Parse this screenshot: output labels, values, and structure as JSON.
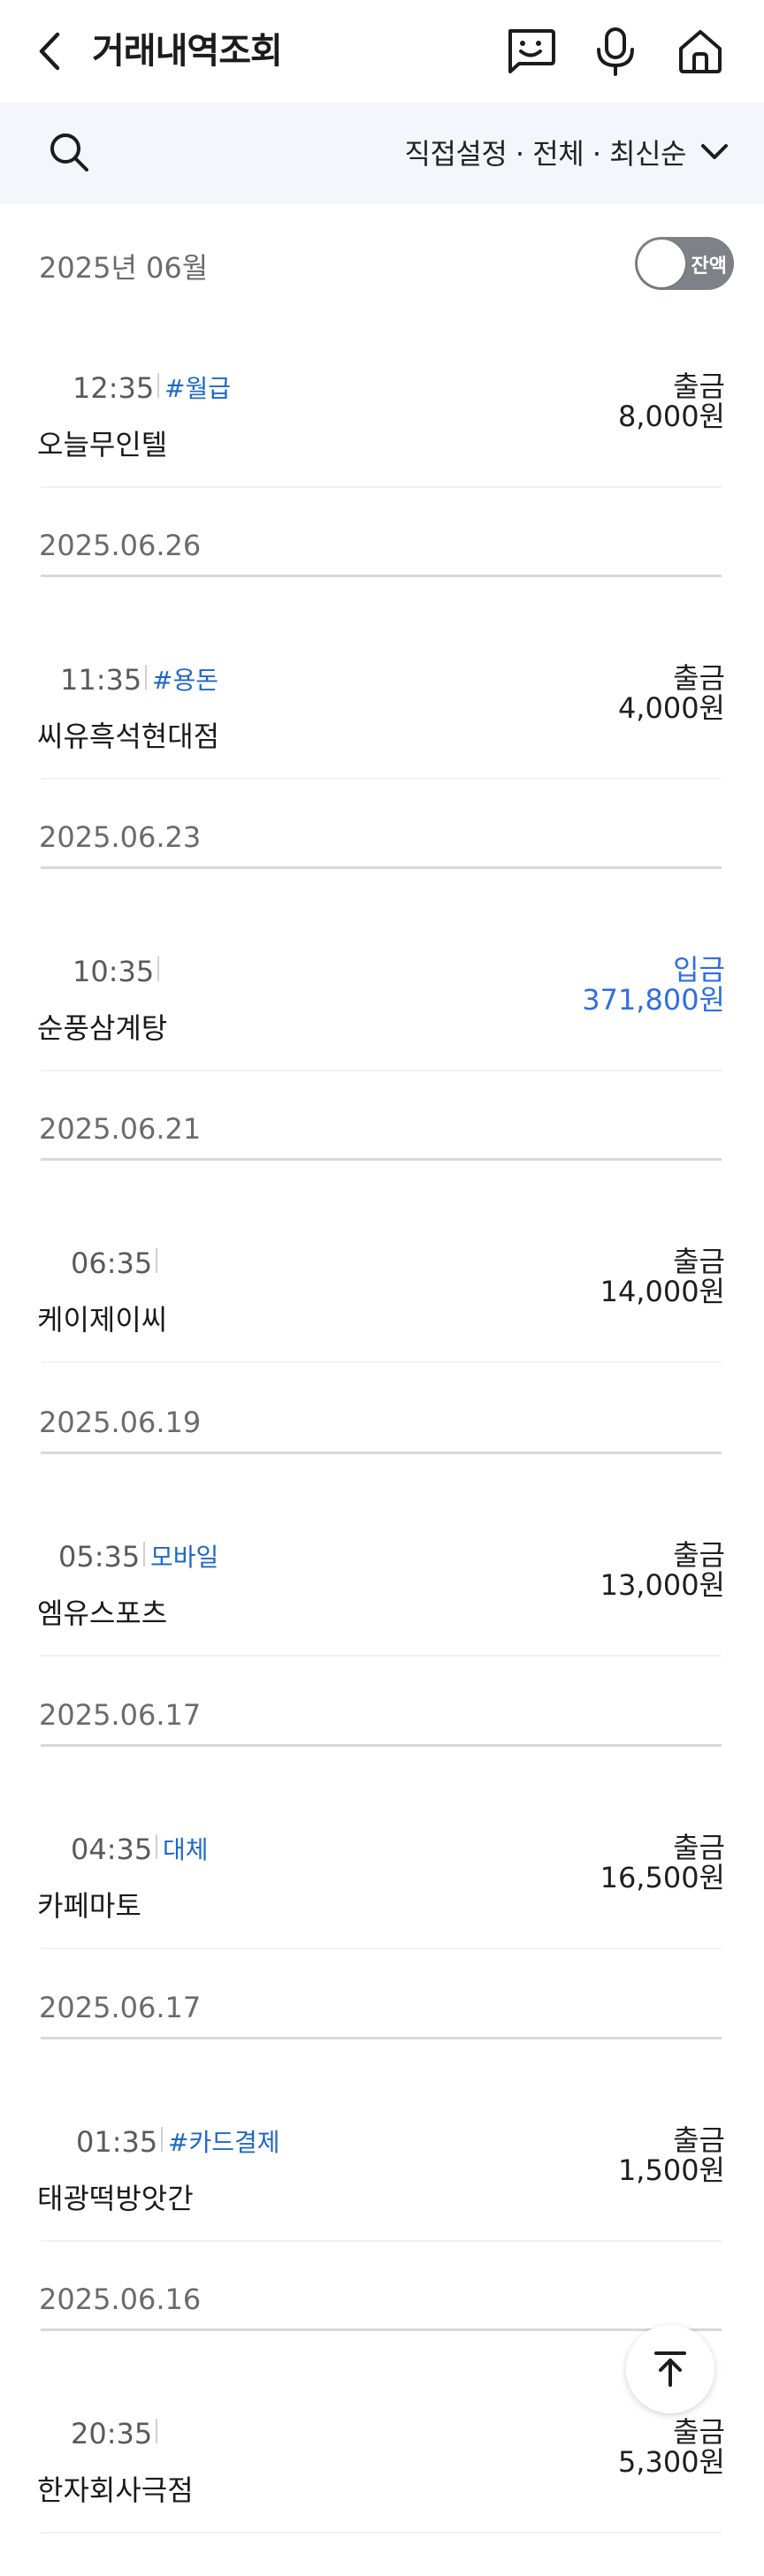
{
  "header": {
    "title": "거래내역조회",
    "icons": [
      "back-arrow-icon",
      "chatbot-icon",
      "microphone-icon",
      "home-icon"
    ]
  },
  "filter": {
    "summary": "직접설정 · 전체 · 최신순"
  },
  "month": {
    "label": "2025년 06월",
    "balance_toggle_label": "잔액",
    "balance_toggle_on": false
  },
  "groups": [
    {
      "date": "",
      "transactions": [
        {
          "time": "12:35",
          "memo": "#월급",
          "name": "오늘무인텔",
          "type": "출금",
          "amount": "8,000원",
          "kind": "withdrawal"
        }
      ]
    },
    {
      "date": "2025.06.26",
      "transactions": [
        {
          "time": "11:35",
          "memo": "#용돈",
          "name": "씨유흑석현대점",
          "type": "출금",
          "amount": "4,000원",
          "kind": "withdrawal"
        }
      ]
    },
    {
      "date": "2025.06.23",
      "transactions": [
        {
          "time": "10:35",
          "memo": "",
          "name": "순풍삼계탕",
          "type": "입금",
          "amount": "371,800원",
          "kind": "deposit"
        }
      ]
    },
    {
      "date": "2025.06.21",
      "transactions": [
        {
          "time": "06:35",
          "memo": "",
          "name": "케이제이씨",
          "type": "출금",
          "amount": "14,000원",
          "kind": "withdrawal"
        }
      ]
    },
    {
      "date": "2025.06.19",
      "transactions": [
        {
          "time": "05:35",
          "memo": "모바일",
          "name": "엠유스포츠",
          "type": "출금",
          "amount": "13,000원",
          "kind": "withdrawal"
        }
      ]
    },
    {
      "date": "2025.06.17",
      "transactions": [
        {
          "time": "04:35",
          "memo": "대체",
          "name": "카페마토",
          "type": "출금",
          "amount": "16,500원",
          "kind": "withdrawal"
        }
      ]
    },
    {
      "date": "2025.06.17",
      "transactions": [
        {
          "time": "01:35",
          "memo": "#카드결제",
          "name": "태광떡방앗간",
          "type": "출금",
          "amount": "1,500원",
          "kind": "withdrawal"
        }
      ]
    },
    {
      "date": "2025.06.16",
      "transactions": [
        {
          "time": "20:35",
          "memo": "",
          "name": "한자회사극점",
          "type": "출금",
          "amount": "5,300원",
          "kind": "withdrawal"
        }
      ]
    }
  ],
  "colors": {
    "accent": "#1f67c7",
    "deposit": "#2f6fe0",
    "filter_bg": "#f3f6fb",
    "toggle_off": "#7e8186"
  },
  "scroll_top_icon": "arrow-up-icon"
}
